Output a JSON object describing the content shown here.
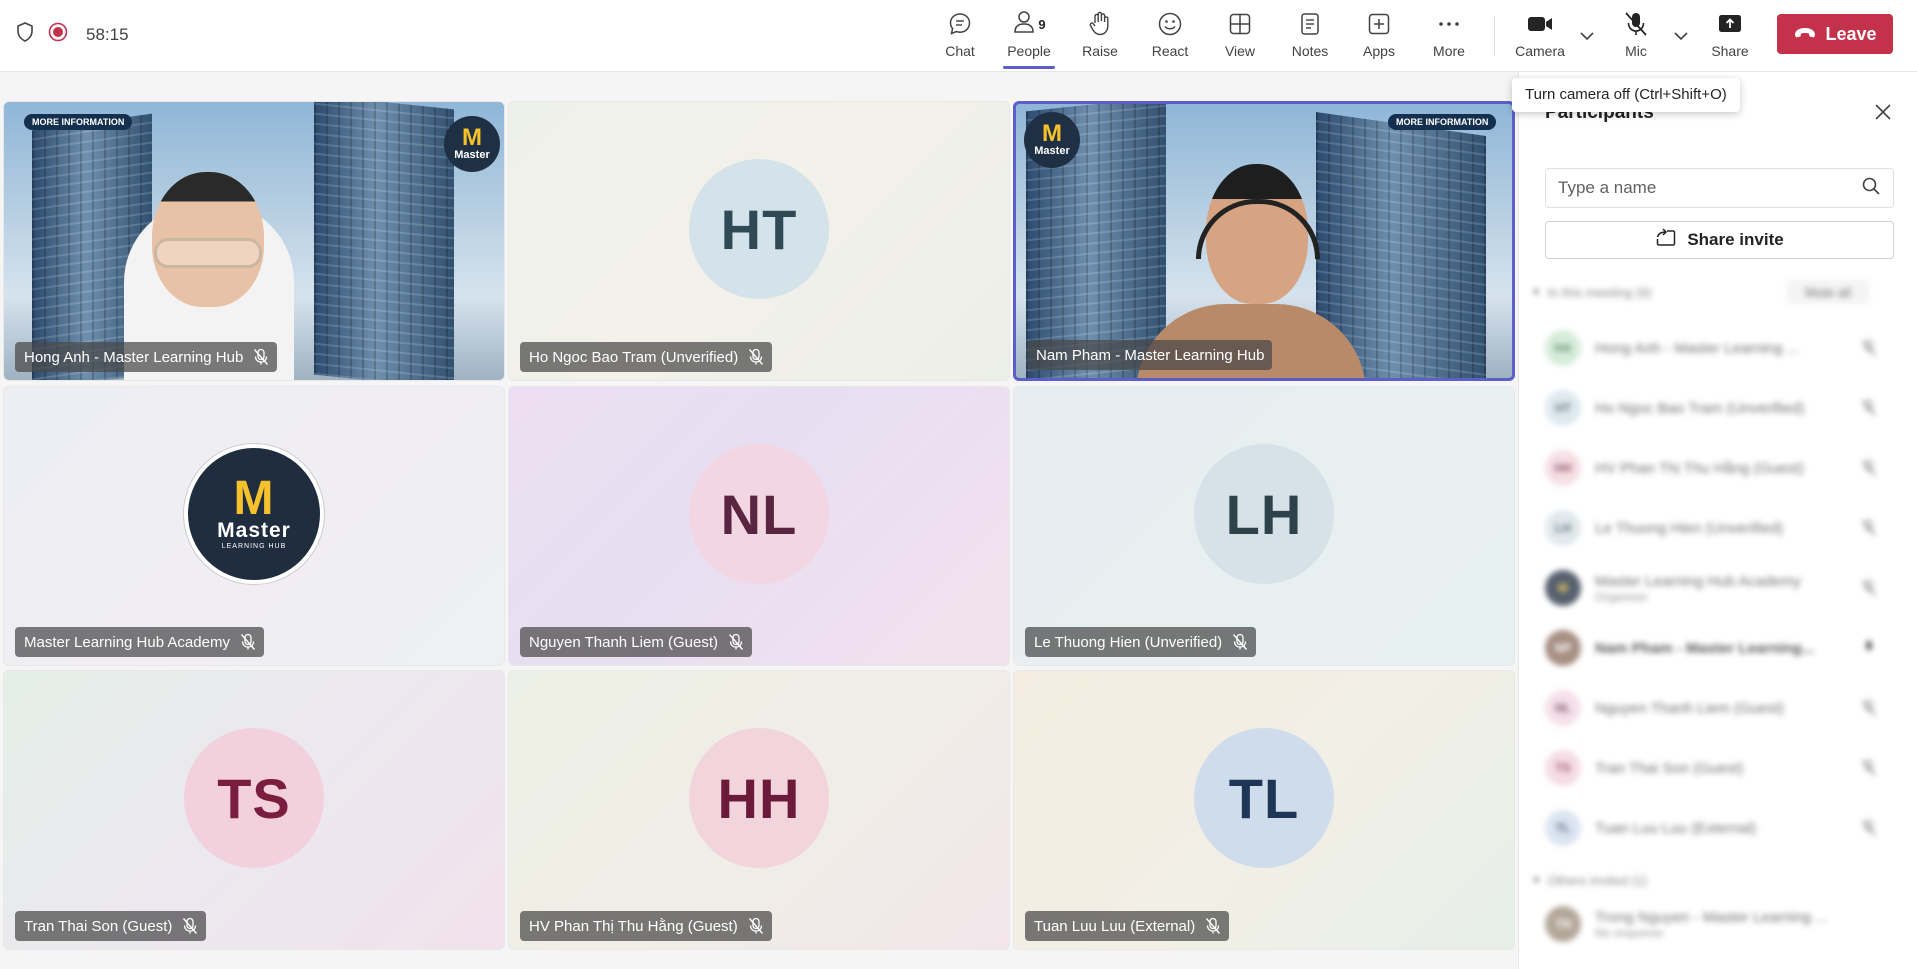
{
  "topbar": {
    "timer": "58:15",
    "buttons": {
      "chat": "Chat",
      "people": "People",
      "people_count": "9",
      "raise": "Raise",
      "react": "React",
      "view": "View",
      "notes": "Notes",
      "apps": "Apps",
      "more": "More",
      "camera": "Camera",
      "mic": "Mic",
      "share": "Share"
    },
    "leave": "Leave"
  },
  "tooltip": "Turn camera off (Ctrl+Shift+O)",
  "tiles": [
    {
      "name": "Hong Anh - Master Learning Hub",
      "type": "video"
    },
    {
      "name": "Ho Ngoc Bao Tram (Unverified)",
      "initials": "HT"
    },
    {
      "name": "Nam Pham - Master Learning Hub",
      "type": "video"
    },
    {
      "name": "Master Learning Hub Academy",
      "type": "logo",
      "logo_main": "Master",
      "logo_sub": "LEARNING HUB"
    },
    {
      "name": "Nguyen Thanh Liem (Guest)",
      "initials": "NL"
    },
    {
      "name": "Le Thuong Hien (Unverified)",
      "initials": "LH"
    },
    {
      "name": "Tran Thai Son (Guest)",
      "initials": "TS"
    },
    {
      "name": "HV Phan Thị Thu Hằng (Guest)",
      "initials": "HH"
    },
    {
      "name": "Tuan Luu Luu (External)",
      "initials": "TL"
    }
  ],
  "video_overlay": {
    "more_info": "MORE INFORMATION",
    "logo_text": "Master"
  },
  "sidebar": {
    "title": "Participants",
    "search_placeholder": "Type a name",
    "share_invite": "Share invite",
    "section_in_meeting": "In this meeting (9)",
    "mute_all": "Mute all",
    "participants": [
      {
        "initials": "HA",
        "name": "Hong Anh - Master Learning ..."
      },
      {
        "initials": "HT",
        "name": "Ho Ngoc Bao Tram (Unverified)"
      },
      {
        "initials": "HH",
        "name": "HV Phan Thị Thu Hằng (Guest)"
      },
      {
        "initials": "LH",
        "name": "Le Thuong Hien (Unverified)"
      },
      {
        "initials": "M",
        "name": "Master Learning Hub Academy",
        "sub": "Organizer"
      },
      {
        "initials": "NP",
        "name": "Nam Pham - Master Learning..."
      },
      {
        "initials": "NL",
        "name": "Nguyen Thanh Liem (Guest)"
      },
      {
        "initials": "TS",
        "name": "Tran Thai Son (Guest)"
      },
      {
        "initials": "TL",
        "name": "Tuan Luu Luu (External)"
      }
    ],
    "section_others": "Others invited (1)",
    "others": [
      {
        "initials": "TN",
        "name": "Trong Nguyen - Master Learning ...",
        "sub": "No response"
      }
    ]
  },
  "colors": {
    "accent": "#5b5fc7",
    "leave": "#c4314b"
  }
}
